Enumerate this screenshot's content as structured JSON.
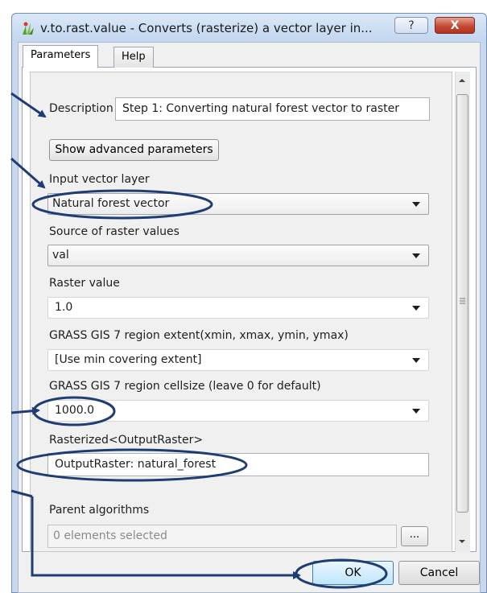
{
  "window": {
    "title": "v.to.rast.value - Converts (rasterize) a vector layer in...",
    "help_glyph": "?",
    "close_glyph": "X"
  },
  "tabs": [
    {
      "label": "Parameters",
      "active": true
    },
    {
      "label": "Help",
      "active": false
    }
  ],
  "form": {
    "description_label": "Description",
    "description_value": "Step 1: Converting natural forest vector to raster",
    "advanced_button": "Show advanced parameters",
    "input_layer_label": "Input vector layer",
    "input_layer_value": "Natural forest vector",
    "source_label": "Source of raster values",
    "source_value": "val",
    "raster_value_label": "Raster value",
    "raster_value_value": "1.0",
    "extent_label": "GRASS GIS 7 region extent(xmin, xmax, ymin, ymax)",
    "extent_value": "[Use min covering extent]",
    "cellsize_label": "GRASS GIS 7 region cellsize (leave 0 for default)",
    "cellsize_value": "1000.0",
    "output_label": "Rasterized<OutputRaster>",
    "output_value": "OutputRaster: natural_forest",
    "parent_label": "Parent algorithms",
    "parent_value": "0 elements selected",
    "parent_button": "..."
  },
  "buttons": {
    "ok": "OK",
    "cancel": "Cancel"
  },
  "colors": {
    "annotation": "#1f3c73",
    "window_frame": "#c7d8ee",
    "close_button": "#c44a33"
  }
}
